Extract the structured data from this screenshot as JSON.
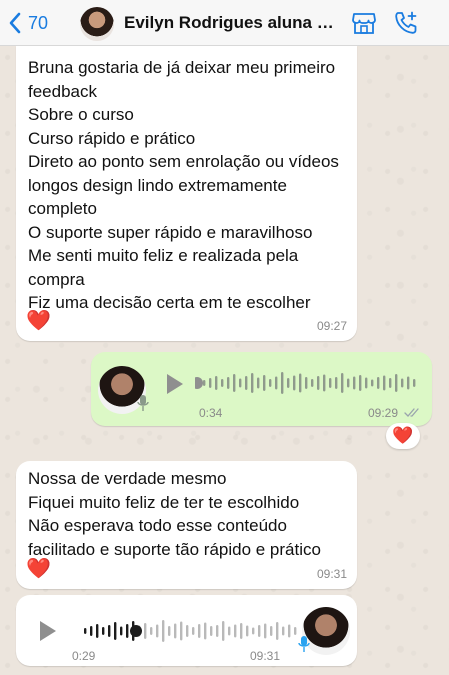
{
  "header": {
    "back_count": "70",
    "contact_name": "Evilyn Rodrigues aluna c...",
    "icons": [
      "chevron-left-icon",
      "storefront-icon",
      "phone-plus-icon"
    ]
  },
  "messages": [
    {
      "type": "text",
      "direction": "incoming",
      "text": "Bruna gostaria de já deixar meu primeiro feedback\nSobre o curso\nCurso rápido e prático\nDireto ao ponto sem enrolação ou vídeos longos design lindo extremamente completo\nO suporte super rápido e maravilhoso\nMe senti muito feliz e realizada pela compra\nFiz uma decisão certa em te escolher",
      "emoji": "❤️",
      "time": "09:27"
    },
    {
      "type": "voice",
      "direction": "outgoing",
      "duration": "0:34",
      "time": "09:29",
      "status": "read",
      "reaction": "❤️"
    },
    {
      "type": "text",
      "direction": "incoming",
      "text": "Nossa de verdade mesmo\nFiquei muito feliz de ter te escolhido\nNão esperava todo esse conteúdo facilitado e suporte tão rápido e prático",
      "emoji": "❤️",
      "time": "09:31"
    },
    {
      "type": "voice",
      "direction": "incoming",
      "position": "0:29",
      "progress": 0.25,
      "time": "09:31"
    }
  ],
  "colors": {
    "accent": "#1a7ce0",
    "outgoing_bubble": "#dcf8c6",
    "incoming_bubble": "#ffffff",
    "heart": "#e0192e",
    "wave_played": "#2aa3f0",
    "wave_unplayed": "#b9b9b9"
  }
}
